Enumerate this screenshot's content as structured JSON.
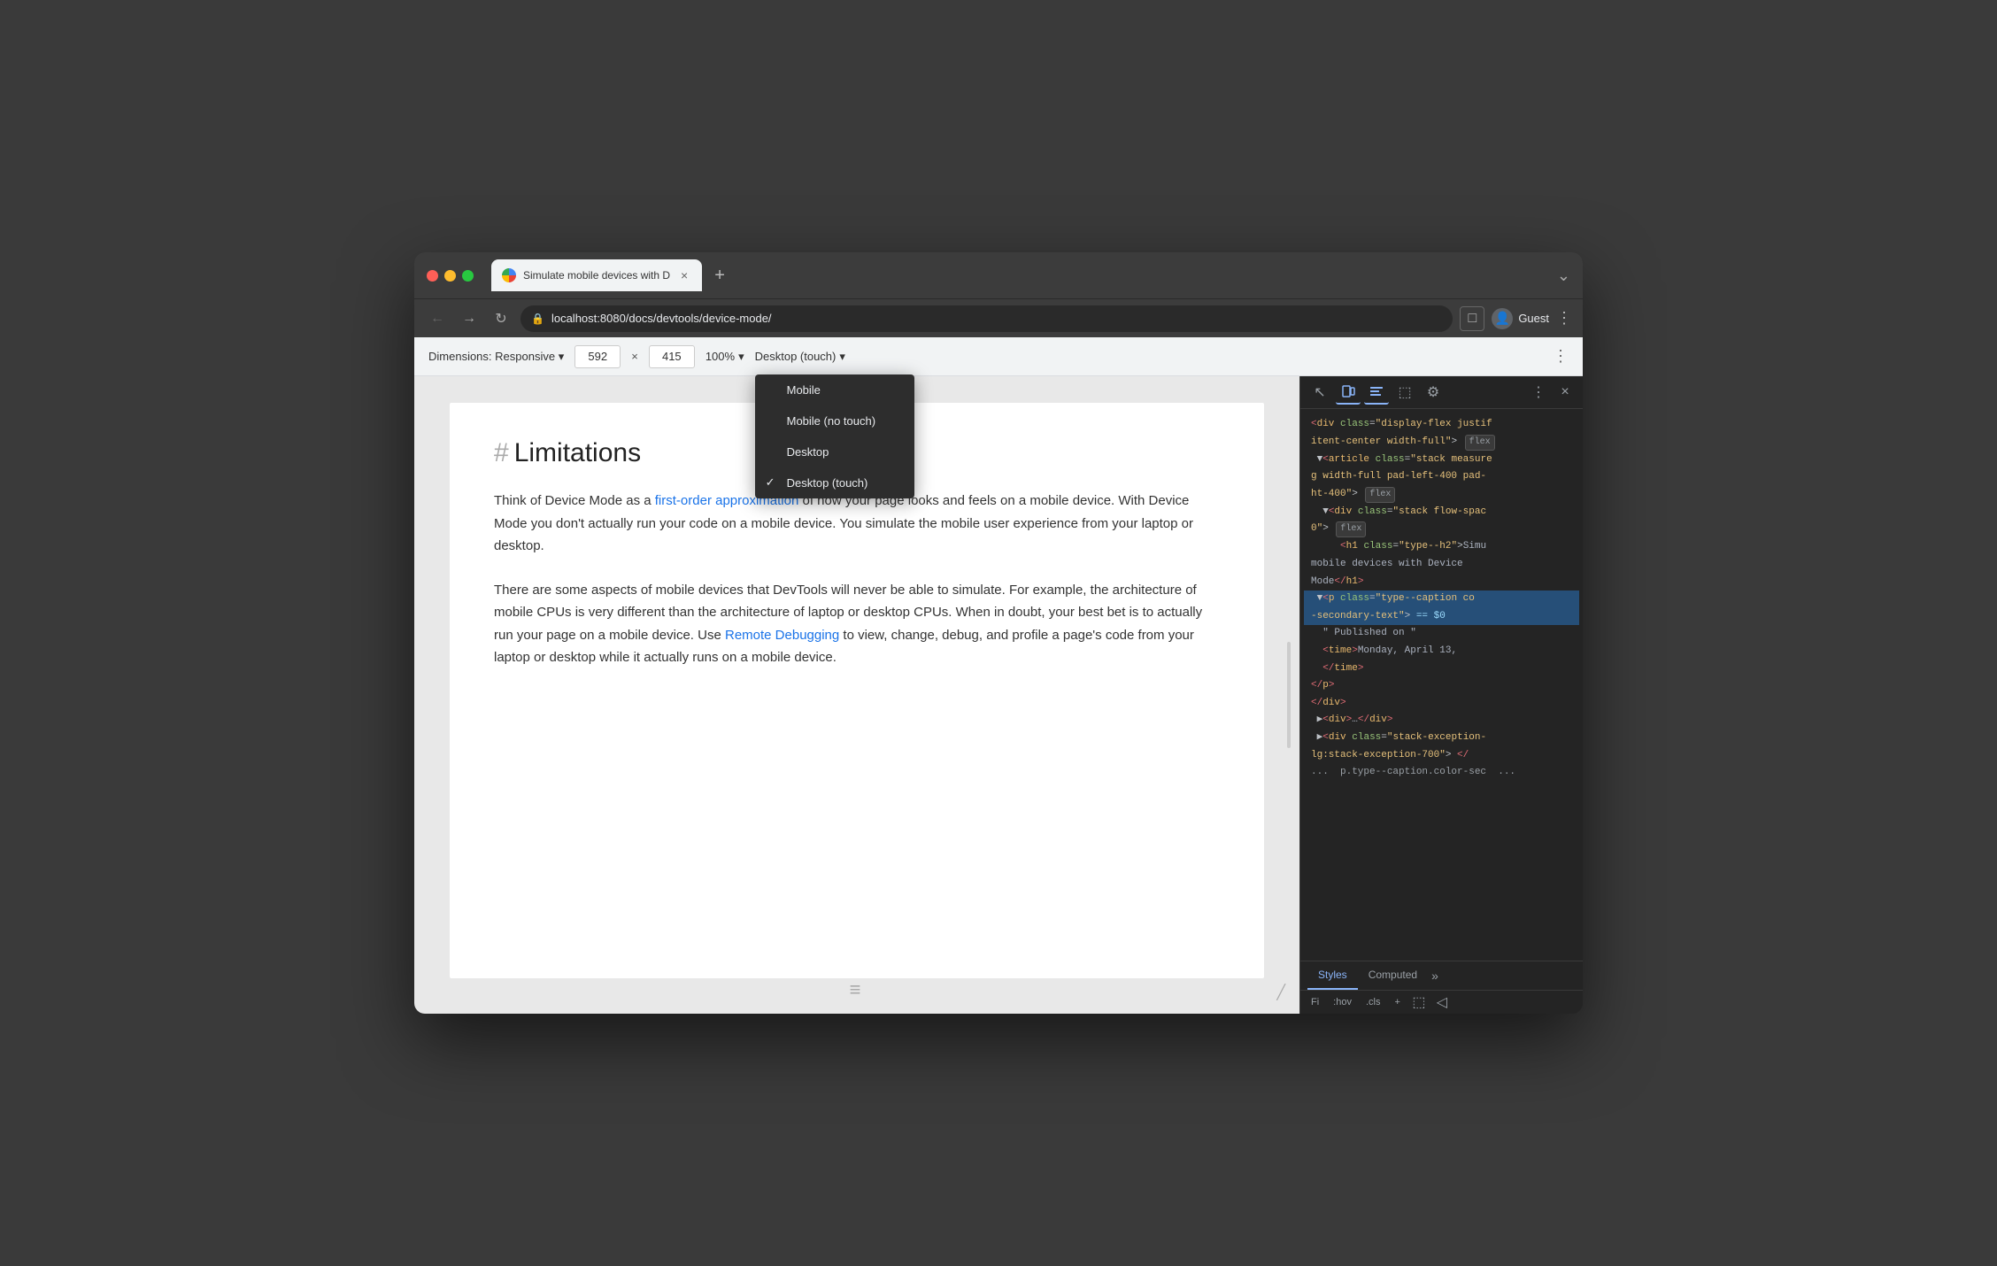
{
  "browser": {
    "title": "Chrome Browser",
    "traffic_lights": {
      "red": "close",
      "yellow": "minimize",
      "green": "maximize"
    },
    "tab": {
      "favicon_alt": "chrome-icon",
      "title": "Simulate mobile devices with D",
      "close_label": "×"
    },
    "new_tab_label": "+",
    "title_bar_chevron": "⌄",
    "nav": {
      "back": "←",
      "forward": "→",
      "refresh": "↻",
      "address": "localhost:8080/docs/devtools/device-mode/",
      "lock_icon": "🔒",
      "devtools_toggle": "□",
      "profile_avatar": "👤",
      "profile_name": "Guest",
      "menu": "⋮"
    }
  },
  "device_toolbar": {
    "dimensions_label": "Dimensions: Responsive",
    "dimensions_arrow": "▾",
    "width_value": "592",
    "height_value": "415",
    "separator": "×",
    "zoom_label": "100%",
    "zoom_arrow": "▾",
    "device_label": "Desktop (touch)",
    "device_arrow": "▾",
    "more_icon": "⋮"
  },
  "dropdown": {
    "items": [
      {
        "label": "Mobile",
        "checked": false
      },
      {
        "label": "Mobile (no touch)",
        "checked": false
      },
      {
        "label": "Desktop",
        "checked": false
      },
      {
        "label": "Desktop (touch)",
        "checked": true
      }
    ]
  },
  "page": {
    "heading_hash": "#",
    "heading_text": "Limitations",
    "paragraphs": [
      {
        "text_before": "Think of Device Mode as a ",
        "link_text": "first-order approximation",
        "text_after": " of how your page looks and feels on a mobile device. With Device Mode you don't actually run your code on a mobile device. You simulate the mobile user experience from your laptop or desktop."
      },
      {
        "text_before": "There are some aspects of mobile devices that DevTools will never be able to simulate. For example, the architecture of mobile CPUs is very different than the architecture of laptop or desktop CPUs. When in doubt, your best bet is to actually run your page on a mobile device. Use ",
        "link_text": "Remote Debugging",
        "text_after": " to view, change, debug, and profile a page's code from your laptop or desktop while it actually runs on a mobile device."
      }
    ]
  },
  "devtools": {
    "toolbar_icons": {
      "cursor": "↖",
      "device": "□",
      "elements": "⬚",
      "console": "≡",
      "gear": "⚙",
      "more": "⋮",
      "close": "×"
    },
    "code_lines": [
      "<div class=\"display-flex justif",
      "itent-center width-full\">",
      "  <article class=\"stack measure",
      "g width-full pad-left-400 pad-",
      "ht-400\">",
      "  <div class=\"stack flow-spac",
      "0\">",
      "    <h1 class=\"type--h2\">Simu",
      "mobile devices with Device",
      "Mode</h1>",
      "<p class=\"type--caption co",
      "-secondary-text\"> == $0",
      "  \" Published on \"",
      "  <time>Monday, April 13,",
      "  </time>",
      "</p>",
      "</div>",
      "<div>…</div>",
      "<div class=\"stack-exception-",
      "lg:stack-exception-700\"> </",
      "...  p.type--caption.color-sec  ..."
    ],
    "badges": [
      "flex",
      "flex",
      "flex"
    ],
    "bottom_tabs": [
      "Styles",
      "Computed",
      "»"
    ],
    "filter_items": [
      "Fi",
      ":hov",
      ".cls",
      "+"
    ],
    "filter_icons": [
      "⬚",
      "◁"
    ]
  }
}
